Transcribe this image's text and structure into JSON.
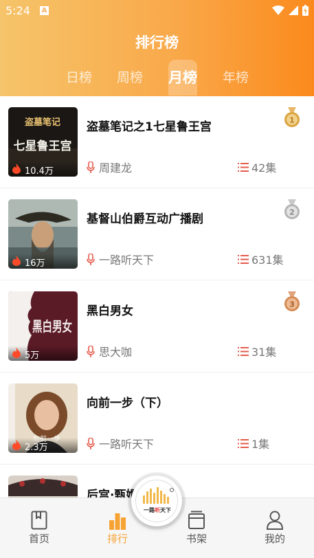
{
  "status_bar": {
    "time": "5:24",
    "notif": "A"
  },
  "header": {
    "title": "排行榜"
  },
  "tabs": [
    {
      "label": "日榜",
      "active": false
    },
    {
      "label": "周榜",
      "active": false
    },
    {
      "label": "月榜",
      "active": true
    },
    {
      "label": "年榜",
      "active": false
    }
  ],
  "items": [
    {
      "title": "盗墓笔记之1七星鲁王宫",
      "author": "周建龙",
      "episodes": "42集",
      "plays": "10.4万",
      "rank": "1",
      "rank_color": "#d9a441"
    },
    {
      "title": "基督山伯爵互动广播剧",
      "author": "一路听天下",
      "episodes": "631集",
      "plays": "16万",
      "rank": "2",
      "rank_color": "#b5b5b5"
    },
    {
      "title": "黑白男女",
      "author": "思大咖",
      "episodes": "31集",
      "plays": "5万",
      "rank": "3",
      "rank_color": "#d58b55"
    },
    {
      "title": "向前一步（下）",
      "author": "一路听天下",
      "episodes": "1集",
      "plays": "2.3万",
      "rank": "",
      "rank_color": ""
    },
    {
      "title": "后宫·甄嬛",
      "author": "",
      "episodes": "",
      "plays": "",
      "rank": "",
      "rank_color": ""
    }
  ],
  "covers": {
    "c1": {
      "text_top": "盗墓笔记",
      "text_main": "七星鲁王宫"
    },
    "c3": {
      "text_main": "黑白男女"
    },
    "c4": {
      "text_main": "向前一步"
    }
  },
  "bottom_nav": [
    {
      "label": "首页",
      "icon": "book-icon",
      "active": false
    },
    {
      "label": "排行",
      "icon": "bar-chart-icon",
      "active": true
    },
    {
      "label": "书架",
      "icon": "bookshelf-icon",
      "active": false
    },
    {
      "label": "我的",
      "icon": "user-icon",
      "active": false
    }
  ],
  "fab": {
    "logo_a": "一路",
    "logo_b": "听",
    "logo_c": "天下"
  },
  "colors": {
    "accent": "#f7a334",
    "header_start": "#f6c46a",
    "header_end": "#fb8a1d",
    "icon_red": "#e65a4a"
  }
}
